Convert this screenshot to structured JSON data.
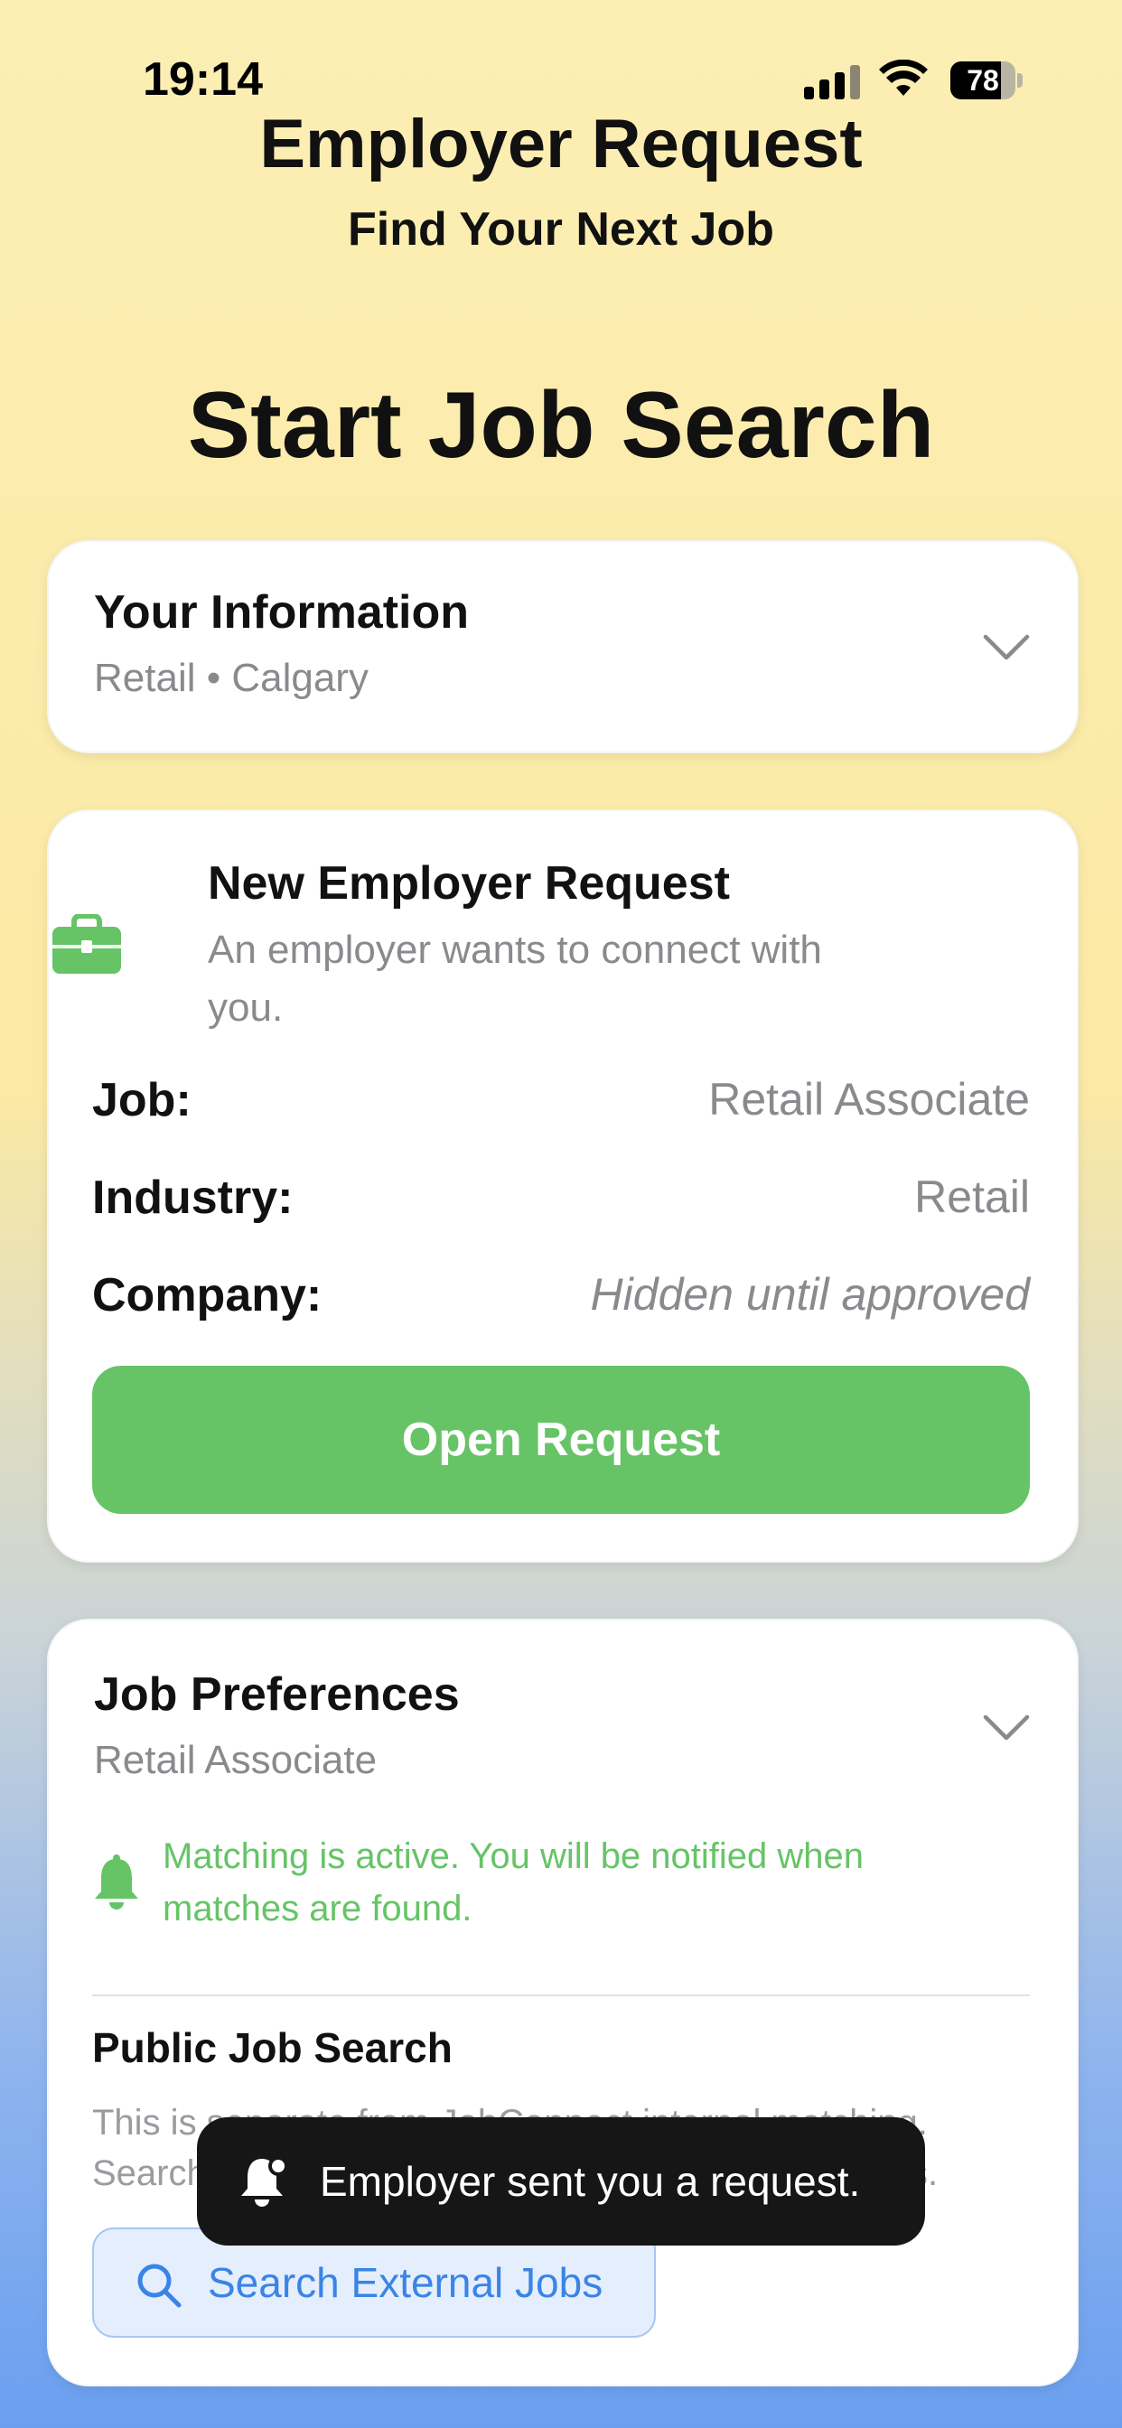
{
  "status_bar": {
    "time": "19:14",
    "battery": "78",
    "battery_level": 0.78
  },
  "header": {
    "title": "Employer Request",
    "subtitle": "Find Your Next Job"
  },
  "page_title": "Start Job Search",
  "info_card": {
    "title": "Your Information",
    "subtitle": "Retail • Calgary"
  },
  "request_card": {
    "title": "New Employer Request",
    "description": "An employer wants to connect with you.",
    "fields": [
      {
        "key": "Job:",
        "value": "Retail Associate"
      },
      {
        "key": "Industry:",
        "value": "Retail"
      },
      {
        "key": "Company:",
        "value": "Hidden until approved"
      }
    ],
    "button_label": "Open Request",
    "accent": "#66c466"
  },
  "preferences_card": {
    "title": "Job Preferences",
    "subtitle": "Retail Associate",
    "matching_note": "Matching is active. You will be notified when matches are found.",
    "public_search_title": "Public Job Search",
    "public_search_desc": "This is separate from JobConnect internal matching. Search external job sites based on your preferences.",
    "search_button_label": "Search External Jobs"
  },
  "toast": {
    "message": "Employer sent you a request."
  },
  "icons": [
    "signal-icon",
    "wifi-icon",
    "battery-icon",
    "chevron-down-icon",
    "briefcase-icon",
    "bell-icon",
    "search-icon"
  ]
}
